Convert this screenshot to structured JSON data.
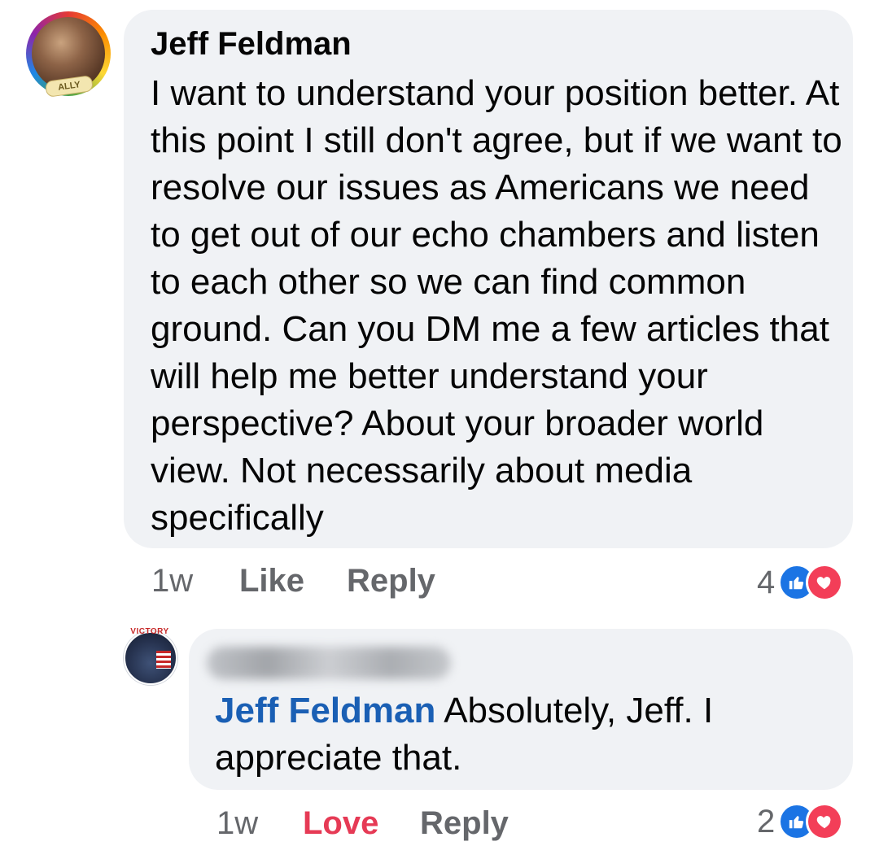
{
  "comment": {
    "author": "Jeff Feldman",
    "avatar_badge": "ALLY",
    "text": "I want to understand your position better. At this point I still don't agree, but if we want to resolve our issues as Americans we need to get out of our echo chambers and listen to each other so we can find common ground. Can you DM me a few articles that will help me better understand your perspective? About your broader world view. Not necessarily about media specifically",
    "time": "1w",
    "like_label": "Like",
    "reply_label": "Reply",
    "reaction_count": "4",
    "reactions": [
      "like-icon",
      "love-icon"
    ]
  },
  "reply": {
    "avatar_badge": "VICTORY",
    "mention": "Jeff Feldman",
    "text": " Absolutely, Jeff. I appreciate that.",
    "time": "1w",
    "love_label": "Love",
    "reply_label": "Reply",
    "reaction_count": "2",
    "reactions": [
      "like-icon",
      "love-icon"
    ]
  },
  "colors": {
    "bubble": "#f0f2f5",
    "mention": "#1a5fb4",
    "love": "#e63a55",
    "meta": "#65676b",
    "like_icon": "#1b74e4",
    "love_icon": "#f33e58"
  }
}
